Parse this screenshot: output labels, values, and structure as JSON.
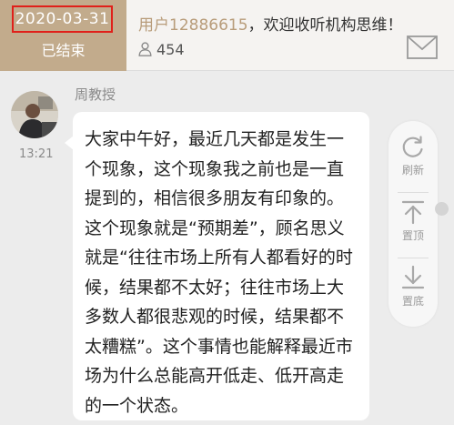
{
  "header": {
    "date": "2020-03-31",
    "status": "已结束",
    "welcome_user": "用户12886615",
    "welcome_rest": "，欢迎收听机构思维！",
    "listener_count": "454",
    "listener_icon": "person-icon",
    "mail_icon": "mail-icon",
    "accent_color": "#c2ab8c",
    "highlight_color": "#e0201a"
  },
  "message": {
    "speaker": "周教授",
    "time": "13:21",
    "text": "大家中午好，最近几天都是发生一个现象，这个现象我之前也是一直提到的，相信很多朋友有印象的。这个现象就是“预期差”，顾名思义就是“往往市场上所有人都看好的时候，结果都不太好；往往市场上大多数人都很悲观的时候，结果都不太糟糕”。这个事情也能解释最近市场为什么总能高开低走、低开高走的一个状态。"
  },
  "toolbar": {
    "refresh_label": "刷新",
    "top_label": "置顶",
    "bottom_label": "置底"
  }
}
